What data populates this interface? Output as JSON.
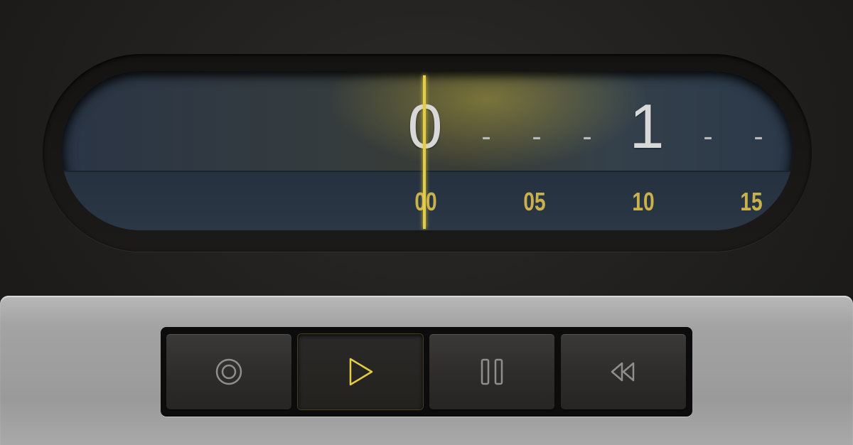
{
  "timeline": {
    "minutes": [
      {
        "type": "digit",
        "text": "0"
      },
      {
        "type": "dash",
        "text": "-"
      },
      {
        "type": "dash",
        "text": "-"
      },
      {
        "type": "dash",
        "text": "-"
      },
      {
        "type": "digit",
        "text": "1"
      },
      {
        "type": "dash",
        "text": "-"
      },
      {
        "type": "dash",
        "text": "-"
      }
    ],
    "seconds": [
      "00",
      "05",
      "10",
      "15"
    ],
    "accent_color": "#e3cd45"
  },
  "controls": [
    {
      "name": "record-button",
      "icon": "record-icon",
      "active": false
    },
    {
      "name": "play-button",
      "icon": "play-icon",
      "active": true
    },
    {
      "name": "pause-button",
      "icon": "pause-icon",
      "active": false
    },
    {
      "name": "rewind-button",
      "icon": "rewind-icon",
      "active": false
    }
  ]
}
